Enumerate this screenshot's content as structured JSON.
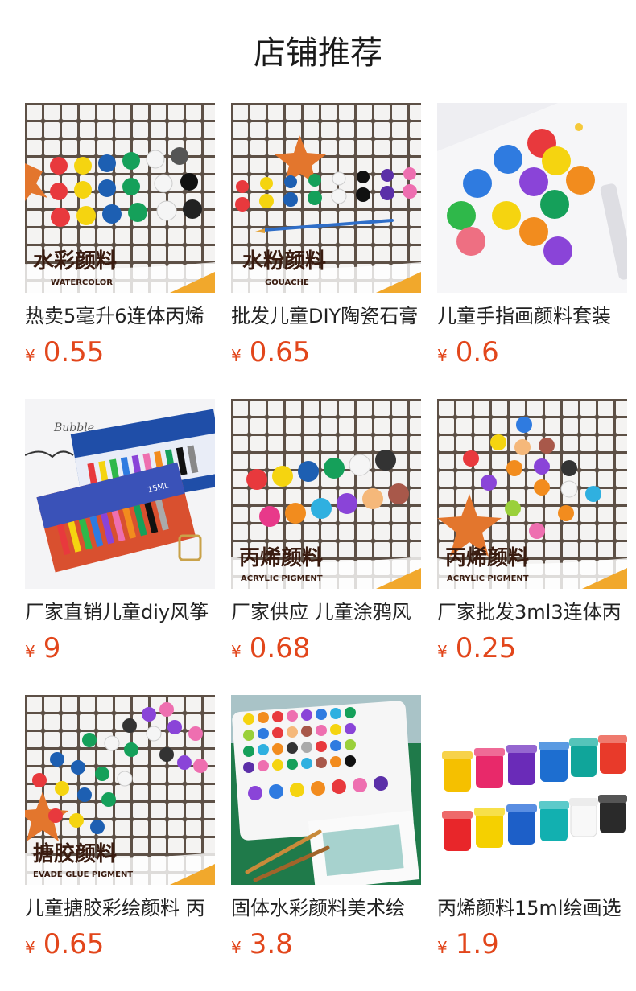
{
  "section": {
    "title": "店铺推荐"
  },
  "currency_symbol": "¥",
  "products": [
    {
      "name": "热卖5毫升6连体丙烯",
      "price": "0.55",
      "image_label": "水彩颜料",
      "image_sublabel": "WATERCOLOR"
    },
    {
      "name": "批发儿童DIY陶瓷石膏",
      "price": "0.65",
      "image_label": "水粉颜料",
      "image_sublabel": "GOUACHE"
    },
    {
      "name": "儿童手指画颜料套装",
      "price": "0.6"
    },
    {
      "name": "厂家直销儿童diy风筝",
      "price": "9",
      "image_label": "Bubble",
      "image_sublabel": "15ML"
    },
    {
      "name": "厂家供应 儿童涂鸦风",
      "price": "0.68",
      "image_label": "丙烯颜料",
      "image_sublabel": "ACRYLIC PIGMENT"
    },
    {
      "name": "厂家批发3ml3连体丙",
      "price": "0.25",
      "image_label": "丙烯颜料",
      "image_sublabel": "ACRYLIC PIGMENT"
    },
    {
      "name": "儿童搪胶彩绘颜料 丙",
      "price": "0.65",
      "image_label": "搪胶颜料",
      "image_sublabel": "EVADE GLUE PIGMENT"
    },
    {
      "name": "固体水彩颜料美术绘",
      "price": "3.8"
    },
    {
      "name": "丙烯颜料15ml绘画选",
      "price": "1.9"
    }
  ],
  "colors": {
    "price": "#e2461b",
    "tile_grout": "#6b5a4a",
    "tile": "#f2f2f2"
  }
}
